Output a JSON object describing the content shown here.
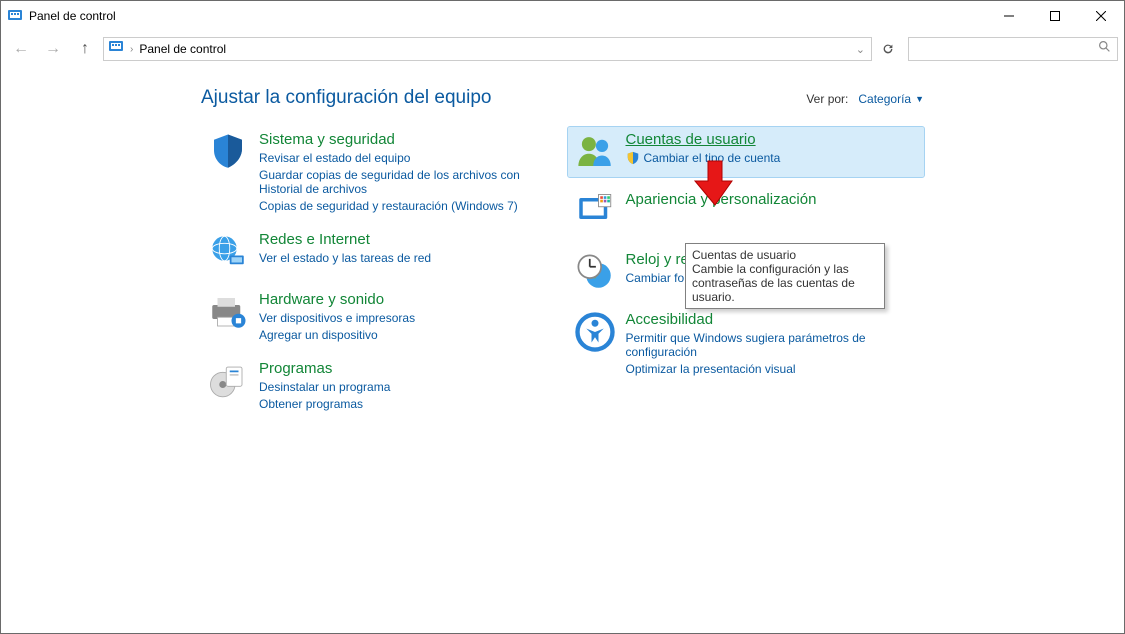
{
  "window": {
    "title": "Panel de control"
  },
  "breadcrumb": {
    "root": "Panel de control"
  },
  "main": {
    "heading": "Ajustar la configuración del equipo",
    "view_by_label": "Ver por:",
    "view_by_value": "Categoría"
  },
  "left_categories": [
    {
      "title": "Sistema y seguridad",
      "links": [
        "Revisar el estado del equipo",
        "Guardar copias de seguridad de los archivos con Historial de archivos",
        "Copias de seguridad y restauración (Windows 7)"
      ]
    },
    {
      "title": "Redes e Internet",
      "links": [
        "Ver el estado y las tareas de red"
      ]
    },
    {
      "title": "Hardware y sonido",
      "links": [
        "Ver dispositivos e impresoras",
        "Agregar un dispositivo"
      ]
    },
    {
      "title": "Programas",
      "links": [
        "Desinstalar un programa",
        "Obtener programas"
      ]
    }
  ],
  "right_categories": [
    {
      "title": "Cuentas de usuario",
      "links": [
        "Cambiar el tipo de cuenta"
      ],
      "shield": true
    },
    {
      "title": "Apariencia y personalización",
      "links": []
    },
    {
      "title": "Reloj y región",
      "links": [
        "Cambiar formatos de fecha, hora o número"
      ]
    },
    {
      "title": "Accesibilidad",
      "links": [
        "Permitir que Windows sugiera parámetros de configuración",
        "Optimizar la presentación visual"
      ]
    }
  ],
  "tooltip": {
    "title": "Cuentas de usuario",
    "body": "Cambie la configuración y las contraseñas de las cuentas de usuario."
  }
}
